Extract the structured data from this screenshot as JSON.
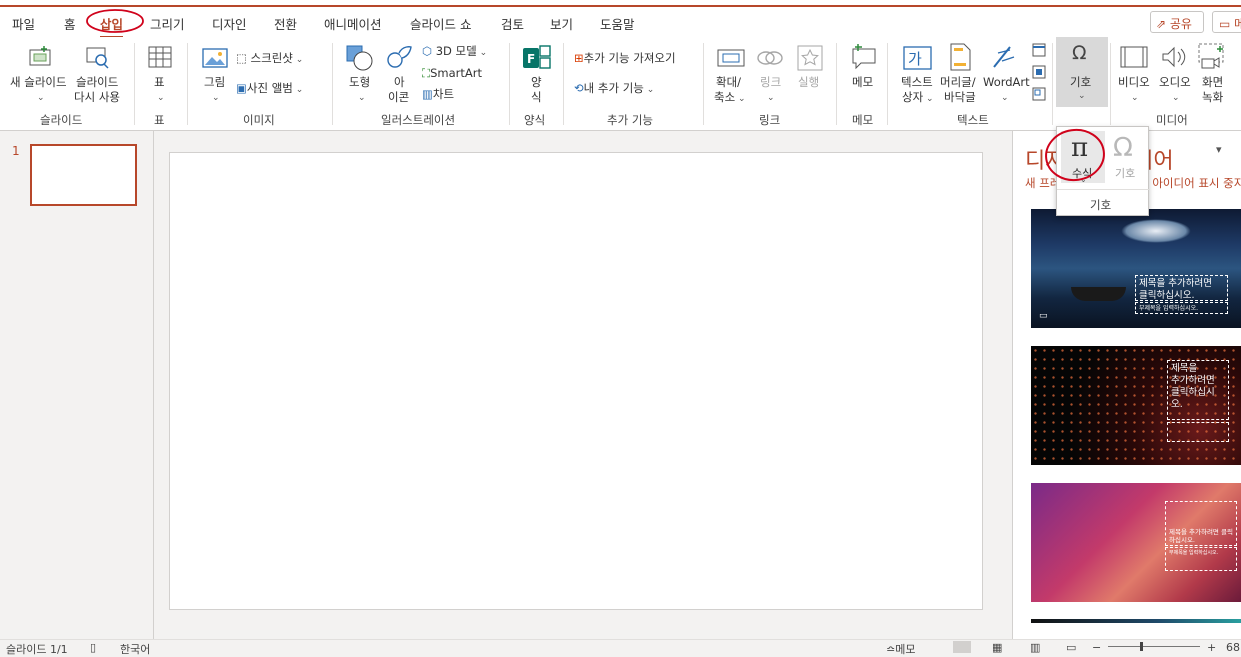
{
  "tabs": [
    "파일",
    "홈",
    "삽입",
    "그리기",
    "디자인",
    "전환",
    "애니메이션",
    "슬라이드 쇼",
    "검토",
    "보기",
    "도움말"
  ],
  "active_tab": "삽입",
  "share_label": "공유",
  "comment_label": "메",
  "ribbon": {
    "slides": {
      "new_slide": [
        "새 슬라이드",
        "⌄"
      ],
      "reuse_slide": [
        "슬라이드",
        "다시 사용"
      ],
      "group": "슬라이드"
    },
    "table": {
      "table": "표",
      "group": "표"
    },
    "images": {
      "picture": "그림",
      "screenshot": "스크린샷",
      "photo_album": "사진 앨범",
      "group": "이미지"
    },
    "illustrations": {
      "shapes": "도형",
      "icons": [
        "아",
        "이콘"
      ],
      "model3d": "3D 모델",
      "smartart": "SmartArt",
      "chart": "차트",
      "group": "일러스트레이션"
    },
    "forms": {
      "form": [
        "양",
        "식"
      ],
      "group": "양식"
    },
    "addins": {
      "get_addins": "추가 기능 가져오기",
      "my_addins": "내 추가 기능",
      "group": "추가 기능"
    },
    "links": {
      "zoom": [
        "확대/",
        "축소"
      ],
      "link": "링크",
      "action": "실행",
      "group": "링크"
    },
    "comments": {
      "comment": "메모",
      "group": "메모"
    },
    "text": {
      "textbox": [
        "텍스트",
        "상자"
      ],
      "header_footer": [
        "머리글/",
        "바닥글"
      ],
      "wordart": "WordArt",
      "group": "텍스트"
    },
    "symbols": {
      "symbols": "기호"
    },
    "media": {
      "video": "비디오",
      "audio": "오디오",
      "screen_recording": [
        "화면",
        "녹화"
      ],
      "group": "미디어"
    }
  },
  "popup": {
    "equation": "수식",
    "symbol": "기호",
    "group": "기호"
  },
  "slide_number": "1",
  "design_pane": {
    "title": "디자인 아이디어",
    "link": "새 프레젠테이션에 디자인 아이디어 표시 중지",
    "idea_text": [
      "제목을 추가하려면",
      "클릭하십시오.",
      "부제목을 입력하십시오."
    ],
    "idea2_text": [
      "제목을",
      "추가하려면",
      "클릭하십시",
      "오."
    ]
  },
  "status": {
    "slide_info": "슬라이드 1/1",
    "language": "한국어",
    "notes": "메모",
    "zoom": "68"
  },
  "colors": {
    "accent": "#b7472a",
    "ribbon_bg": "#ffffff",
    "app_bg": "#f3f2f1"
  }
}
